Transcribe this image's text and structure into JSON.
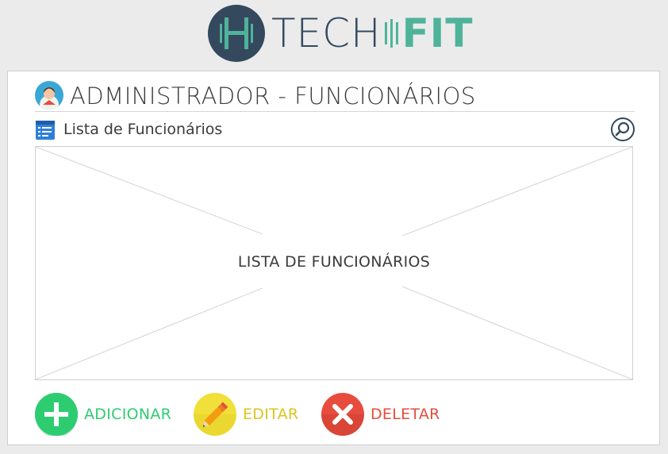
{
  "logo": {
    "text_tech": "TECH",
    "text_fit": "FIT",
    "badge_letter": "H"
  },
  "header": {
    "title": "ADMINISTRADOR - FUNCIONÁRIOS",
    "icon": "admin-user-icon"
  },
  "list": {
    "label": "Lista de Funcionários",
    "placeholder": "LISTA DE FUNCIONÁRIOS",
    "search_icon": "search-icon"
  },
  "actions": {
    "add_label": "ADICIONAR",
    "edit_label": "EDITAR",
    "delete_label": "DELETAR"
  },
  "colors": {
    "brand_dark": "#34495e",
    "brand_green": "#4fb39a",
    "add": "#2ecc71",
    "edit": "#e6d72b",
    "delete": "#e74c3c"
  }
}
